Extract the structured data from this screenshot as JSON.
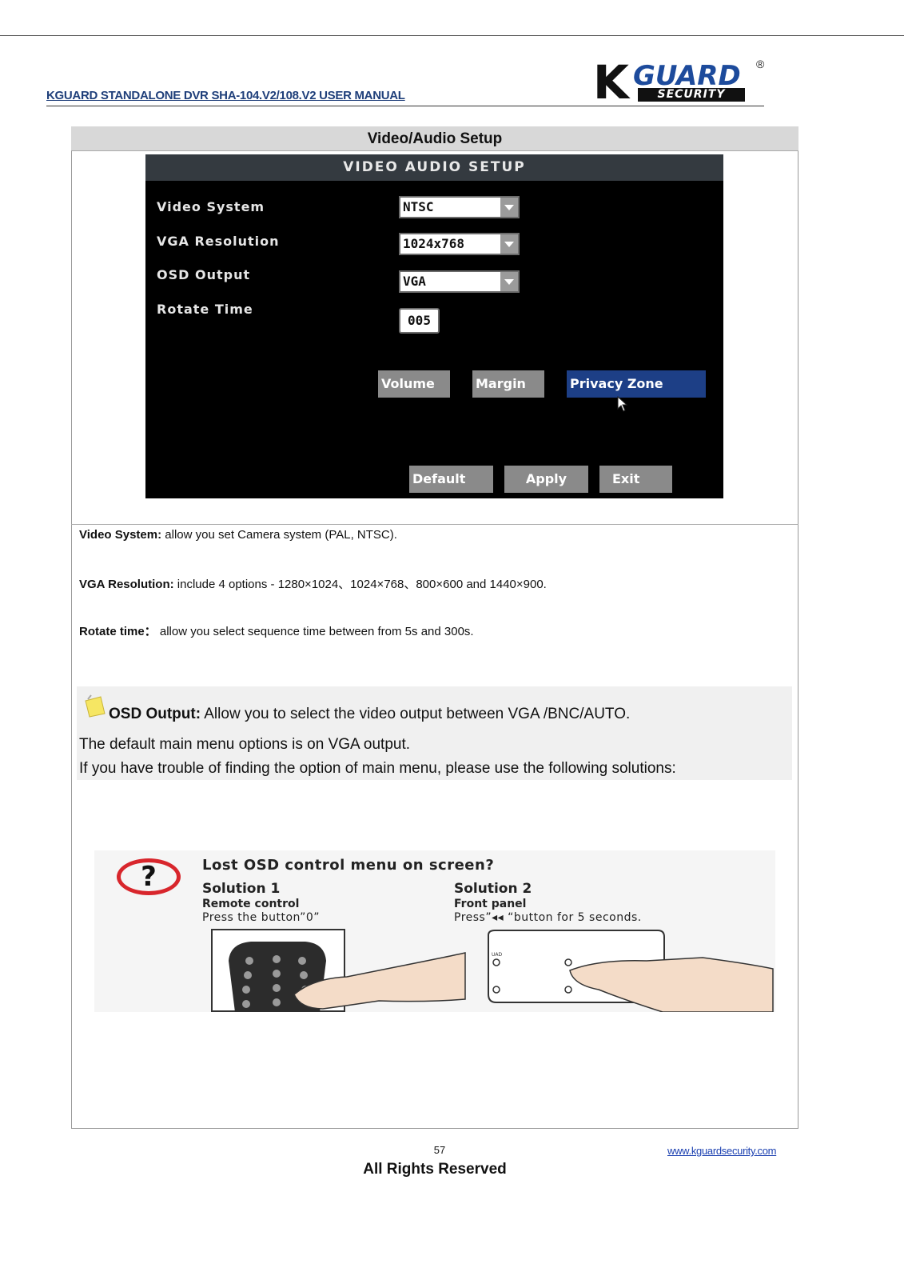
{
  "header": {
    "manual_title": "KGUARD STANDALONE DVR SHA-104.V2/108.V2 USER MANUAL",
    "logo": {
      "k": "K",
      "guard": "GUARD",
      "security": "SECURITY",
      "reg": "®"
    }
  },
  "section": {
    "title": "Video/Audio Setup"
  },
  "dvr_screen": {
    "title": "VIDEO AUDIO SETUP",
    "fields": [
      {
        "label": "Video System",
        "value": "NTSC"
      },
      {
        "label": "VGA Resolution",
        "value": "1024x768"
      },
      {
        "label": "OSD Output",
        "value": "VGA"
      },
      {
        "label": "Rotate Time",
        "value": "005"
      }
    ],
    "buttons_row1": [
      "Volume",
      "Margin",
      "Privacy Zone"
    ],
    "buttons_row2": [
      "Default",
      "Apply",
      "Exit"
    ]
  },
  "descriptions": [
    {
      "term": "Video System:",
      "text": " allow you set Camera system (PAL, NTSC)."
    },
    {
      "term": "VGA Resolution:",
      "text": " include 4 options - 1280×1024、1024×768、800×600 and 1440×900."
    },
    {
      "term": "Rotate time：",
      "text": " allow you select sequence time between from 5s and 300s."
    }
  ],
  "note": {
    "term": "OSD Output:",
    "text": " Allow you to select the video output between VGA /BNC/AUTO.",
    "line2": "The default main menu options is on VGA output.",
    "line3": "If you have trouble of finding the option of main menu, please use the following solutions:"
  },
  "illustration": {
    "title": "Lost OSD control menu on screen?",
    "solution1": {
      "title": "Solution 1",
      "sub": "Remote control",
      "text": "Press the button”0”"
    },
    "solution2": {
      "title": "Solution 2",
      "sub": "Front panel",
      "text": "Press”◂◂ “button for 5 seconds."
    },
    "panel_label": "UAD"
  },
  "footer": {
    "page_number": "57",
    "website": "www.kguardsecurity.com",
    "rights": "All Rights Reserved"
  }
}
